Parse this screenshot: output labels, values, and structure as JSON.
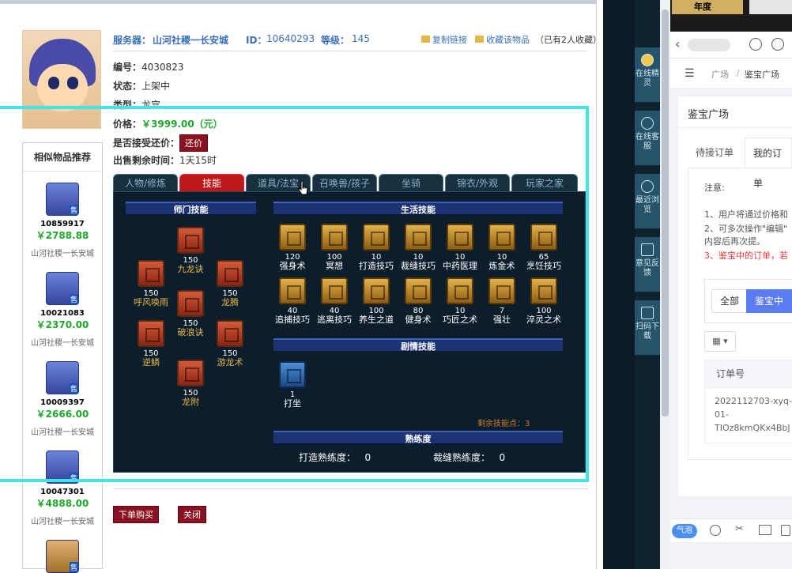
{
  "item": {
    "server_label": "服务器：",
    "server_value": "山河社稷一长安城",
    "id_label": "ID：",
    "id_value": "10640293",
    "level_label": "等级：",
    "level_value": "145",
    "copy_link": "复制链接",
    "favorite": "收藏该物品",
    "fav_count": "（已有2人收藏）",
    "code_label": "编号：",
    "code_value": "4030823",
    "status_label": "状态：",
    "status_value": "上架中",
    "type_label": "类型：",
    "type_value": "龙宫",
    "price_label": "价格：",
    "price_value": "￥3999.00（元）",
    "bargain_label": "是否接受还价：",
    "bargain_button": "还价",
    "remaining_label": "出售剩余时间：",
    "remaining_value": "1天15时",
    "buy_button": "下单购买",
    "close_button": "关闭"
  },
  "similar": {
    "title": "相似物品推荐",
    "items": [
      {
        "id": "10859917",
        "price": "￥2788.88",
        "server": "山河社稷一长安城"
      },
      {
        "id": "10021083",
        "price": "￥2370.00",
        "server": "山河社稷一长安城"
      },
      {
        "id": "10009397",
        "price": "￥2666.00",
        "server": "山河社稷一长安城"
      },
      {
        "id": "10047301",
        "price": "￥4888.00",
        "server": "山河社稷一长安城"
      }
    ]
  },
  "tabs": [
    "人物/修炼",
    "技能",
    "道具/法宝",
    "召唤兽/孩子",
    "坐骑",
    "锦衣/外观",
    "玩家之家"
  ],
  "sections": {
    "school": "师门技能",
    "life": "生活技能",
    "story": "剧情技能",
    "proficiency": "熟练度"
  },
  "school_skills": [
    {
      "name": "九龙诀",
      "level": "150"
    },
    {
      "name": "呼风唤雨",
      "level": "150"
    },
    {
      "name": "龙腾",
      "level": "150"
    },
    {
      "name": "破浪诀",
      "level": "150"
    },
    {
      "name": "逆鳞",
      "level": "150"
    },
    {
      "name": "游龙术",
      "level": "150"
    },
    {
      "name": "龙附",
      "level": "150"
    }
  ],
  "life_skills": [
    {
      "name": "强身术",
      "level": "120"
    },
    {
      "name": "冥想",
      "level": "100"
    },
    {
      "name": "打造技巧",
      "level": "10"
    },
    {
      "name": "裁缝技巧",
      "level": "10"
    },
    {
      "name": "中药医理",
      "level": "10"
    },
    {
      "name": "炼金术",
      "level": "10"
    },
    {
      "name": "烹饪技巧",
      "level": "65"
    },
    {
      "name": "追捕技巧",
      "level": "40"
    },
    {
      "name": "逃离技巧",
      "level": "40"
    },
    {
      "name": "养生之道",
      "level": "100"
    },
    {
      "name": "健身术",
      "level": "80"
    },
    {
      "name": "巧匠之术",
      "level": "10"
    },
    {
      "name": "强壮",
      "level": "7"
    },
    {
      "name": "淬灵之术",
      "level": "100"
    }
  ],
  "story_skills": [
    {
      "name": "打坐",
      "level": "1"
    }
  ],
  "remaining_points": "剩余技能点：3",
  "proficiency": {
    "forging_label": "打造熟练度：",
    "forging_value": "0",
    "tailoring_label": "裁缝熟练度：",
    "tailoring_value": "0"
  },
  "nav": [
    {
      "label": "在线精灵"
    },
    {
      "label": "在线客服"
    },
    {
      "label": "最近浏览"
    },
    {
      "label": "意见反馈"
    },
    {
      "label": "扫码下载"
    }
  ],
  "right": {
    "banner_text": "年度",
    "breadcrumb_home": "广场",
    "breadcrumb_sep": "/",
    "breadcrumb_current": "鉴宝广场",
    "card_title": "鉴宝广场",
    "tab_pending": "待接订单",
    "tab_mine": "我的订单",
    "notice_title": "注意:",
    "notice_1": "1、用户将通过价格和",
    "notice_2": "2、可多次操作\"编辑\"",
    "notice_2b": "内容后再次提。",
    "notice_3": "3、鉴宝中的订单，若",
    "filter_all": "全部",
    "filter_active": "鉴宝中",
    "col_order": "订单号",
    "order_line1": "2022112703-xyq-",
    "order_line2": "01-",
    "order_line3": "TIOz8kmQKx4BbJ",
    "bubble": "气泡"
  },
  "colors": {
    "accent_blue": "#3a6fb6",
    "price_green": "#1ea82a",
    "skill_gold": "#e8b84a",
    "tab_active": "#c01818",
    "highlight_cyan": "#3fe6e6"
  }
}
